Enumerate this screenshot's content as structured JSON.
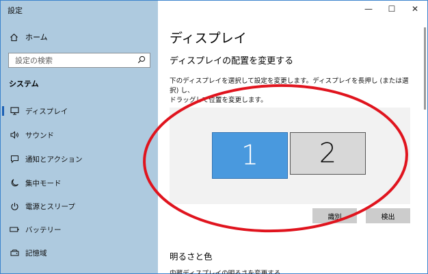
{
  "window": {
    "title": "設定",
    "controls": {
      "minimize": "—",
      "maximize": "☐",
      "close": "✕"
    }
  },
  "sidebar": {
    "home": {
      "label": "ホーム",
      "icon": "home-icon"
    },
    "search": {
      "placeholder": "設定の検索",
      "icon": "search-icon"
    },
    "section": "システム",
    "items": [
      {
        "label": "ディスプレイ",
        "icon": "monitor-icon",
        "selected": true
      },
      {
        "label": "サウンド",
        "icon": "speaker-icon"
      },
      {
        "label": "通知とアクション",
        "icon": "notification-icon"
      },
      {
        "label": "集中モード",
        "icon": "moon-icon"
      },
      {
        "label": "電源とスリープ",
        "icon": "power-icon"
      },
      {
        "label": "バッテリー",
        "icon": "battery-icon"
      },
      {
        "label": "記憶域",
        "icon": "storage-icon"
      }
    ]
  },
  "main": {
    "title": "ディスプレイ",
    "arrange": {
      "heading": "ディスプレイの配置を変更する",
      "description_line1": "下のディスプレイを選択して設定を変更します。ディスプレイを長押し (または選択) し、",
      "description_line2": "ドラッグして位置を変更します。",
      "monitor1": "1",
      "monitor2": "2",
      "identify_label": "識別",
      "detect_label": "検出"
    },
    "brightness": {
      "heading": "明るさと色",
      "partial_text": "内蔵ディスプレイの明るさを変更する"
    }
  },
  "colors": {
    "sidebar_bg": "#aecadf",
    "selected_monitor": "#4999de",
    "annotation_ellipse": "#e0141e"
  }
}
